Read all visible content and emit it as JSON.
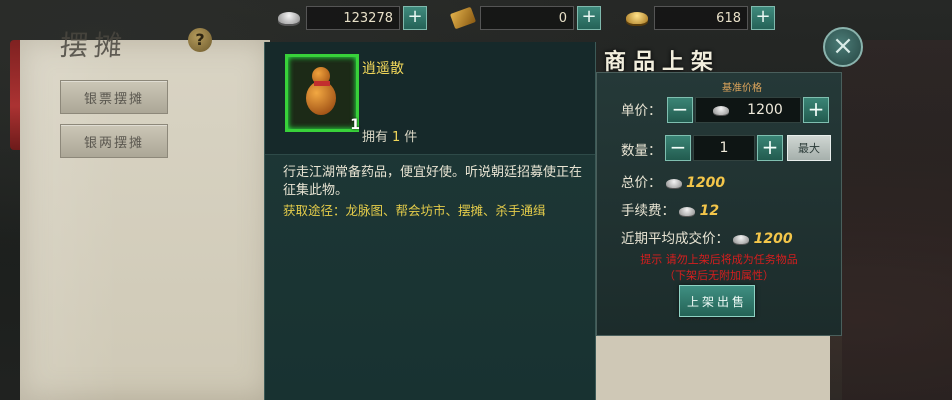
{
  "currency": [
    {
      "icon": "silver-ingot-icon",
      "value": "123278"
    },
    {
      "icon": "ticket-icon",
      "value": "0"
    },
    {
      "icon": "gold-ingot-icon",
      "value": "618"
    }
  ],
  "background": {
    "title": "摆摊",
    "buttons": [
      "银票摆摊",
      "银两摆摊"
    ]
  },
  "item": {
    "name": "逍遥散",
    "count_badge": "1",
    "own_label_prefix": "拥有",
    "own_count": "1",
    "own_label_suffix": "件",
    "description": "行走江湖常备药品，便宜好使。听说朝廷招募使正在征集此物。",
    "source": "获取途径：龙脉图、帮会坊市、摆摊、杀手通缉"
  },
  "listing": {
    "title": "商品上架",
    "ref_price_label": "基准价格",
    "unit_price_label": "单价：",
    "unit_price": "1200",
    "quantity_label": "数量：",
    "quantity": "1",
    "max_label": "最大",
    "total_label": "总价：",
    "total": "1200",
    "fee_label": "手续费：",
    "fee": "12",
    "avg_label": "近期平均成交价：",
    "avg": "1200",
    "warning_line1": "提示  请勿上架后将成为任务物品",
    "warning_line2": "（下架后无附加属性）",
    "submit_label": "上架出售"
  }
}
